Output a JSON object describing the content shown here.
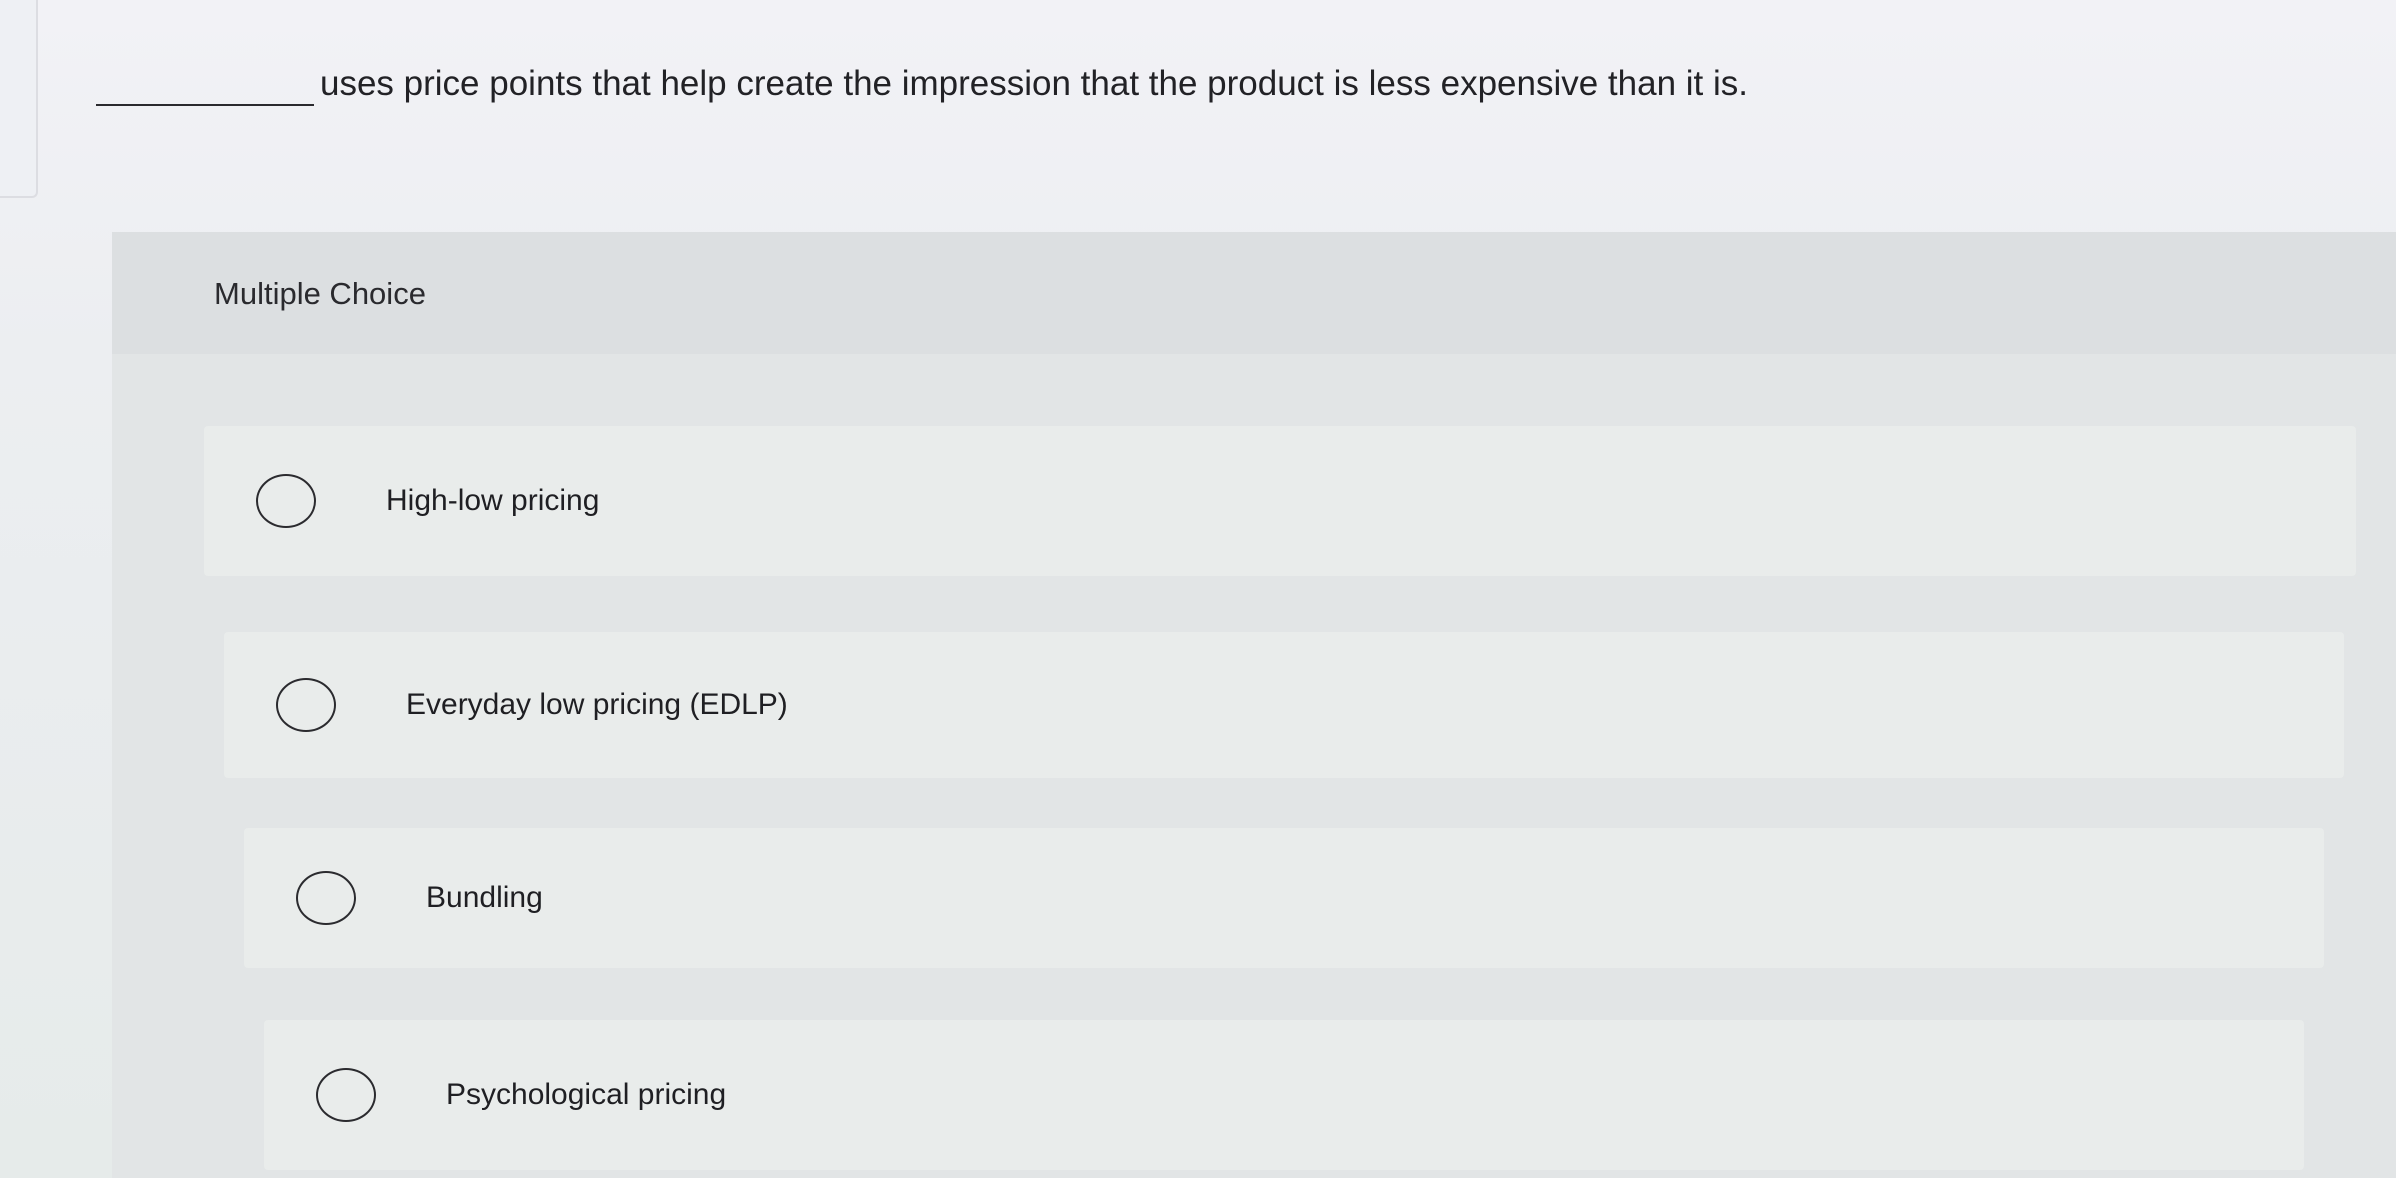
{
  "question": {
    "text": "uses price points that help create the impression that the product is less expensive than it is."
  },
  "section_label": "Multiple Choice",
  "options": [
    {
      "label": "High-low pricing",
      "selected": false
    },
    {
      "label": "Everyday low pricing (EDLP)",
      "selected": false
    },
    {
      "label": "Bundling",
      "selected": false
    },
    {
      "label": "Psychological pricing",
      "selected": false
    }
  ]
}
